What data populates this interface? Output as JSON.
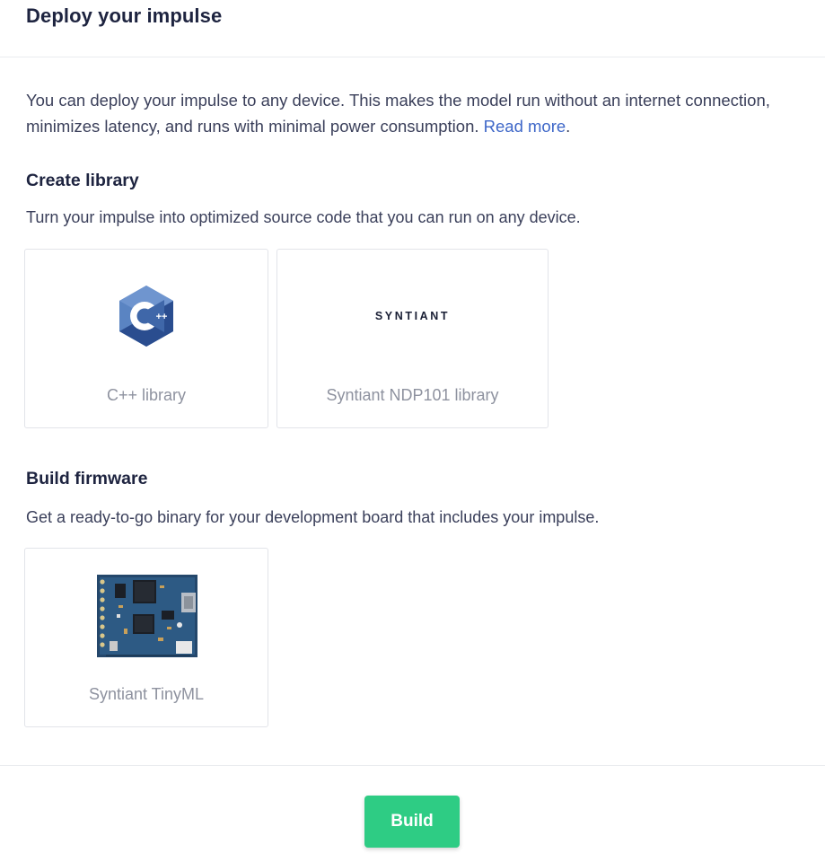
{
  "page": {
    "title": "Deploy your impulse",
    "intro_text": "You can deploy your impulse to any device. This makes the model run without an internet connection, minimizes latency, and runs with minimal power consumption. ",
    "read_more_link": "Read more",
    "read_more_suffix": "."
  },
  "create_library": {
    "title": "Create library",
    "description": "Turn your impulse into optimized source code that you can run on any device.",
    "cards": [
      {
        "label": "C++ library",
        "icon": "cpp-logo-icon",
        "logo_text": "C++"
      },
      {
        "label": "Syntiant NDP101 library",
        "icon": "syntiant-logo",
        "logo_text": "SYNTIANT"
      }
    ]
  },
  "build_firmware": {
    "title": "Build firmware",
    "description": "Get a ready-to-go binary for your development board that includes your impulse.",
    "cards": [
      {
        "label": "Syntiant TinyML",
        "icon": "circuit-board-image"
      }
    ]
  },
  "footer": {
    "build_label": "Build"
  },
  "colors": {
    "link": "#3e67c8",
    "build_button": "#2ecc84",
    "cpp_logo_dark": "#2a4d8f",
    "cpp_logo_light": "#5a84c2"
  }
}
